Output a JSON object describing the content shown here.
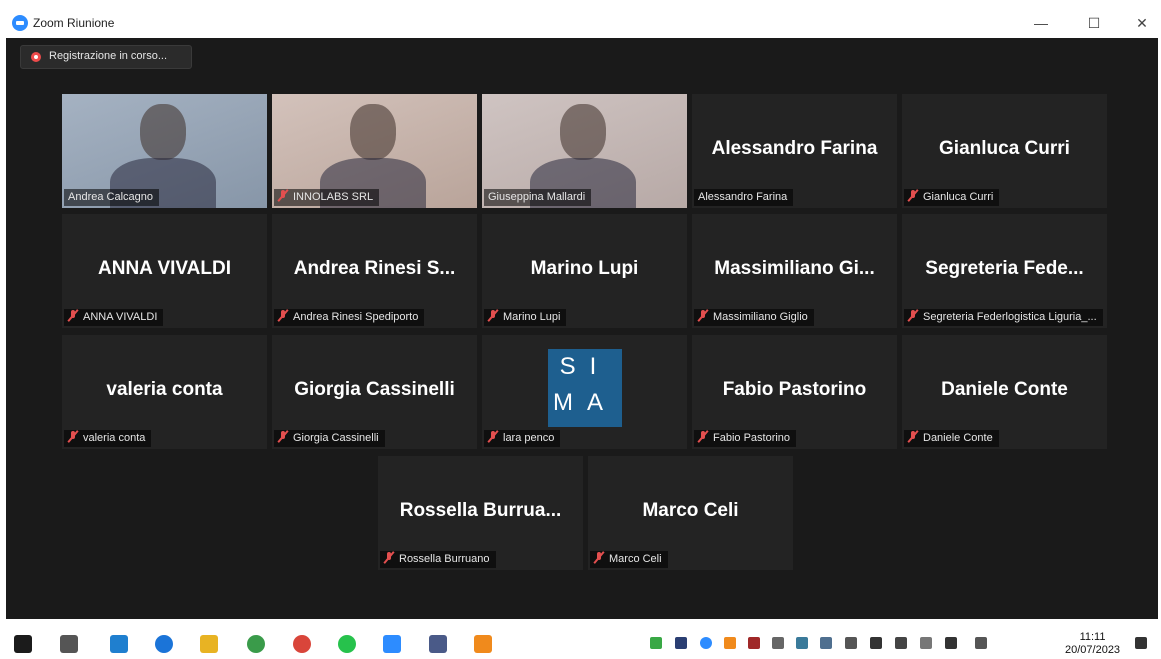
{
  "window": {
    "title": "Zoom Riunione",
    "minimize_glyph": "—",
    "maximize_glyph": "☐",
    "close_glyph": "✕"
  },
  "recording": {
    "label": "Registrazione in corso..."
  },
  "participants": [
    {
      "name": "Andrea Calcagno",
      "label": "",
      "video": true,
      "muted": false,
      "active": true
    },
    {
      "name": "INNOLABS SRL",
      "label": "",
      "video": true,
      "muted": true,
      "active": false
    },
    {
      "name": "Giuseppina Mallardi",
      "label": "",
      "video": true,
      "muted": false,
      "active": false
    },
    {
      "name": "Alessandro Farina",
      "label": "Alessandro Farina",
      "video": false,
      "muted": false
    },
    {
      "name": "Gianluca Curri",
      "label": "Gianluca Curri",
      "video": false,
      "muted": true
    },
    {
      "name": "ANNA VIVALDI",
      "label": "ANNA VIVALDI",
      "video": false,
      "muted": true
    },
    {
      "name": "Andrea Rinesi Spediporto",
      "label": "Andrea Rinesi S...",
      "video": false,
      "muted": true
    },
    {
      "name": "Marino Lupi",
      "label": "Marino Lupi",
      "video": false,
      "muted": true
    },
    {
      "name": "Massimiliano Giglio",
      "label": "Massimiliano Gi...",
      "video": false,
      "muted": true
    },
    {
      "name": "Segreteria Federlogistica Liguria_...",
      "label": "Segreteria Fede...",
      "video": false,
      "muted": true
    },
    {
      "name": "valeria conta",
      "label": "valeria conta",
      "video": false,
      "muted": true
    },
    {
      "name": "Giorgia Cassinelli",
      "label": "Giorgia Cassinelli",
      "video": false,
      "muted": true
    },
    {
      "name": "lara penco",
      "label": "",
      "video": false,
      "muted": true,
      "logo": "S I M A"
    },
    {
      "name": "Fabio Pastorino",
      "label": "Fabio Pastorino",
      "video": false,
      "muted": true
    },
    {
      "name": "Daniele Conte",
      "label": "Daniele Conte",
      "video": false,
      "muted": true
    },
    {
      "name": "Rossella Burruano",
      "label": "Rossella Burrua...",
      "video": false,
      "muted": true
    },
    {
      "name": "Marco Celi",
      "label": "Marco Celi",
      "video": false,
      "muted": true
    }
  ],
  "sima_logo": {
    "row1": "SI",
    "row2": "MA"
  },
  "taskbar": {
    "time": "11:11",
    "date": "20/07/2023",
    "colors": {
      "accent": "#2d8cff",
      "mute_red": "#e34f4f",
      "active_speaker": "#c9e34b"
    }
  }
}
